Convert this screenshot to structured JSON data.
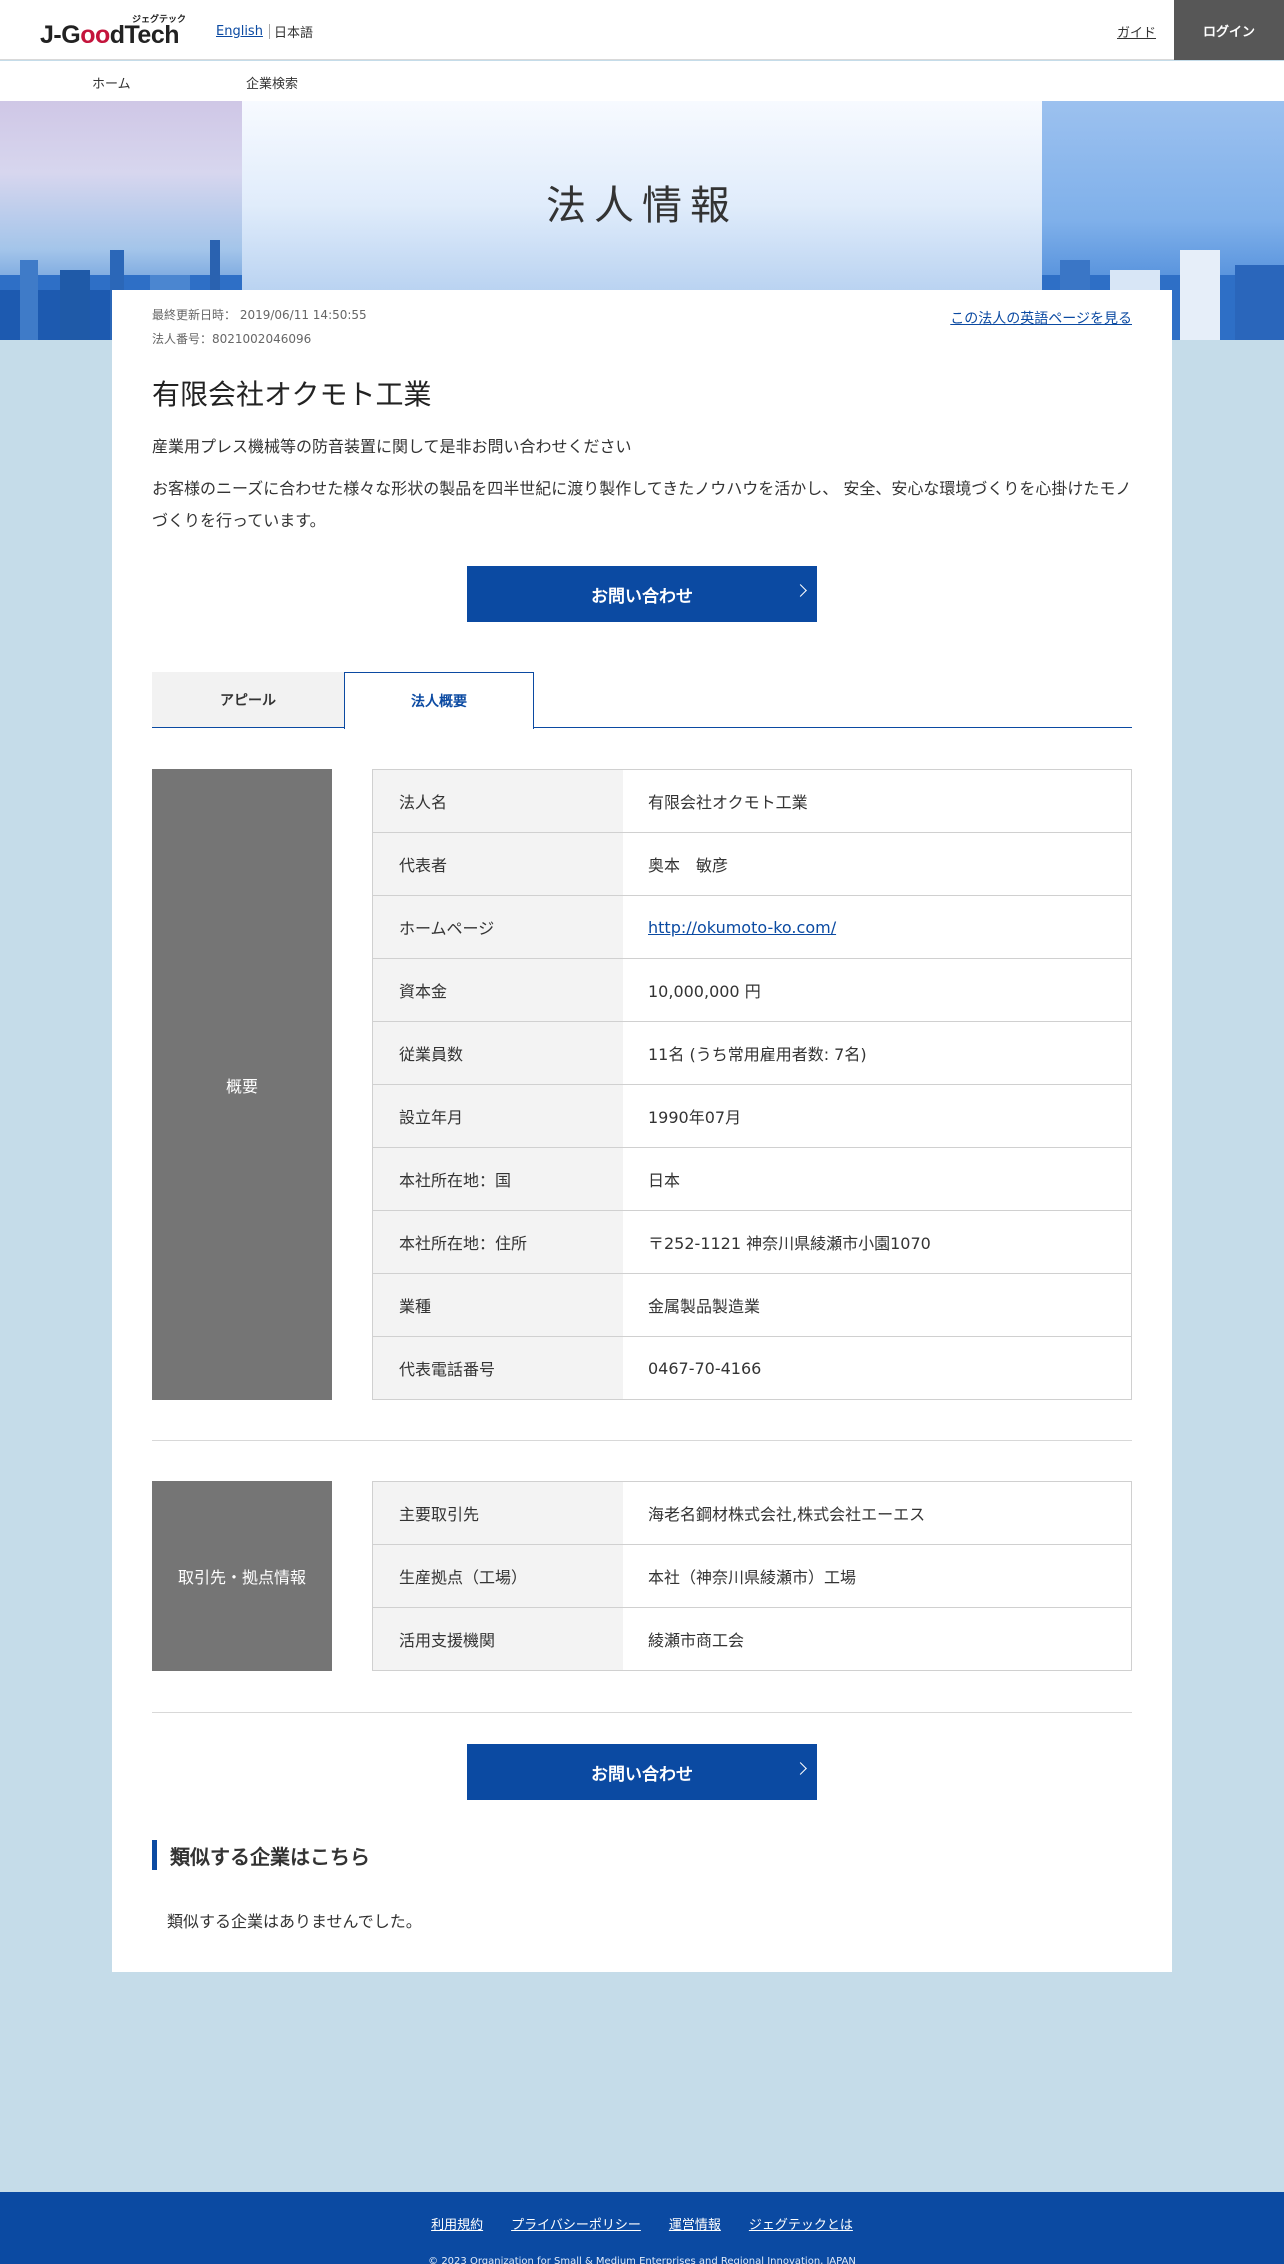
{
  "header": {
    "logo_kana": "ジェグテック",
    "logo_prefix": "J-G",
    "logo_oo": "oo",
    "logo_suffix": "dTech",
    "lang_en": "English",
    "lang_ja": "日本語",
    "guide": "ガイド",
    "login": "ログイン"
  },
  "nav": {
    "home": "ホーム",
    "search": "企業検索"
  },
  "hero": {
    "title": "法人情報"
  },
  "meta": {
    "updated": "最終更新日時： 2019/06/11 14:50:55",
    "corp_no": "法人番号：8021002046096"
  },
  "en_page_link": "この法人の英語ページを見る",
  "company": {
    "name": "有限会社オクモト工業",
    "catch": "産業用プレス機械等の防音装置に関して是非お問い合わせください",
    "desc": "お客様のニーズに合わせた様々な形状の製品を四半世紀に渡り製作してきたノウハウを活かし、 安全、安心な環境づくりを心掛けたモノづくりを行っています。"
  },
  "contact_button": "お問い合わせ",
  "tabs": {
    "appeal": "アピール",
    "profile": "法人概要"
  },
  "overview": {
    "label": "概要",
    "rows": [
      {
        "k": "法人名",
        "v": "有限会社オクモト工業"
      },
      {
        "k": "代表者",
        "v": "奥本　敏彦"
      },
      {
        "k": "ホームページ",
        "v": "http://okumoto-ko.com/"
      },
      {
        "k": "資本金",
        "v": "10,000,000 円"
      },
      {
        "k": "従業員数",
        "v": "11名 (うち常用雇用者数: 7名)"
      },
      {
        "k": "設立年月",
        "v": "1990年07月"
      },
      {
        "k": "本社所在地：国",
        "v": "日本"
      },
      {
        "k": "本社所在地：住所",
        "v": "〒252-1121 神奈川県綾瀬市小園1070"
      },
      {
        "k": "業種",
        "v": "金属製品製造業"
      },
      {
        "k": "代表電話番号",
        "v": "0467-70-4166"
      }
    ]
  },
  "partners": {
    "label": "取引先・拠点情報",
    "rows": [
      {
        "k": "主要取引先",
        "v": "海老名鋼材株式会社,株式会社エーエス"
      },
      {
        "k": "生産拠点（工場）",
        "v": "本社（神奈川県綾瀬市）工場"
      },
      {
        "k": "活用支援機関",
        "v": "綾瀬市商工会"
      }
    ]
  },
  "similar": {
    "title": "類似する企業はこちら",
    "none": "類似する企業はありませんでした。"
  },
  "footer": {
    "terms": "利用規約",
    "privacy": "プライバシーポリシー",
    "operation": "運営情報",
    "about": "ジェグテックとは",
    "copyright": "© 2023 Organization for Small & Medium Enterprises and Regional Innovation, JAPAN"
  }
}
